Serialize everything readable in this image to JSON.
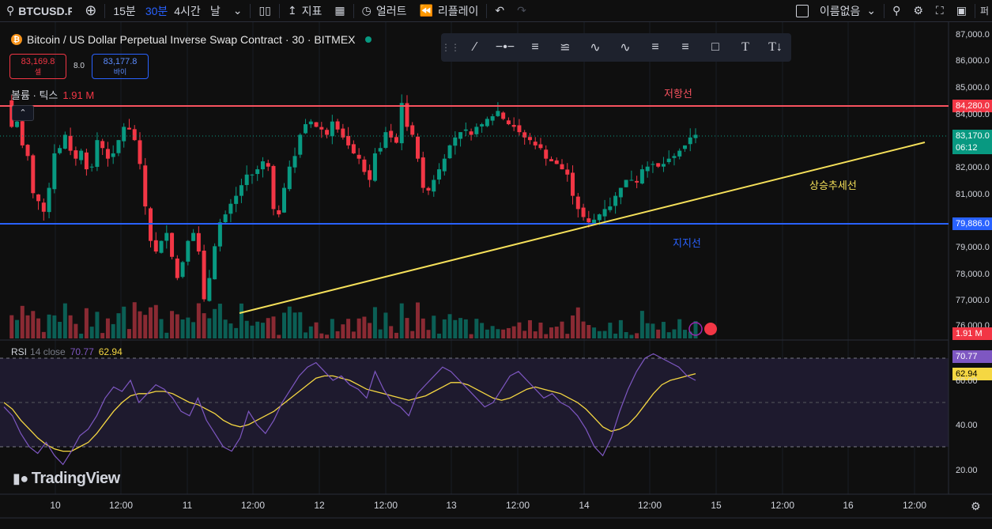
{
  "topbar": {
    "symbol": "BTCUSD.P",
    "intervals": [
      "15분",
      "30분",
      "4시간",
      "날"
    ],
    "active_interval": "30분",
    "indicators_label": "지표",
    "alert_label": "얼러트",
    "replay_label": "리플레이",
    "layout_name": "이름없음",
    "trailing": "퍼"
  },
  "legend": {
    "title": "Bitcoin / US Dollar Perpetual Inverse Swap Contract · 30 · BITMEX",
    "sell_price": "83,169.8",
    "sell_label": "셀",
    "spread": "8.0",
    "buy_price": "83,177.8",
    "buy_label": "바이",
    "volume_label": "볼륨 · 틱스",
    "volume_value": "1.91 M"
  },
  "annotations": {
    "resistance": "저항선",
    "support": "지지선",
    "uptrend": "상승추세선"
  },
  "price_axis": {
    "ticks": [
      "87,000.0",
      "86,000.0",
      "85,000.0",
      "84,000.0",
      "82,000.0",
      "81,000.0",
      "79,000.0",
      "78,000.0",
      "77,000.0",
      "76,000.0"
    ],
    "resistance_tag": "84,280.0",
    "last_price_tag": "83,170.0",
    "countdown": "06:12",
    "support_tag": "79,886.0",
    "volume_tag": "1.91 M"
  },
  "rsi": {
    "label": "RSI",
    "params": "14 close",
    "rsi_value": "70.77",
    "ma_value": "62.94",
    "axis_ticks": [
      "60.00",
      "40.00",
      "20.00"
    ]
  },
  "time_axis": {
    "labels": [
      "10",
      "12:00",
      "11",
      "12:00",
      "12",
      "12:00",
      "13",
      "12:00",
      "14",
      "12:00",
      "15",
      "12:00",
      "16",
      "12:00"
    ]
  },
  "branding": {
    "logo_text": "TradingView"
  },
  "colors": {
    "up": "#089981",
    "down": "#f23645",
    "resistance": "#f7525f",
    "support": "#2962ff",
    "trendline": "#f5e05a",
    "rsi_line": "#7e57c2",
    "rsi_ma": "#f5d742",
    "last_price": "#089981"
  },
  "chart_data": {
    "type": "candlestick",
    "symbol": "BTCUSD.P",
    "interval": "30",
    "x_labels": [
      "10",
      "12:00",
      "11",
      "12:00",
      "12",
      "12:00",
      "13",
      "12:00",
      "14",
      "12:00",
      "15",
      "12:00",
      "16",
      "12:00"
    ],
    "y_range": [
      75800,
      87200
    ],
    "resistance_level": 84280,
    "support_level": 79886,
    "last_price": 83170,
    "trendline": {
      "from_price": 76600,
      "to_price": 82900
    },
    "close_path": [
      84500,
      83500,
      83700,
      82800,
      82400,
      81000,
      80700,
      80300,
      81200,
      82500,
      82700,
      83200,
      82600,
      82300,
      82600,
      81900,
      82000,
      83000,
      82700,
      82300,
      82500,
      83000,
      83500,
      83400,
      83000,
      82100,
      80500,
      79200,
      78800,
      79200,
      79500,
      78600,
      77800,
      78400,
      79200,
      79500,
      78800,
      77000,
      77800,
      79000,
      79900,
      80200,
      80600,
      80900,
      81300,
      81700,
      81700,
      81900,
      82200,
      82000,
      80400,
      80200,
      81200,
      82000,
      82400,
      83200,
      83600,
      83700,
      83500,
      83400,
      83200,
      83700,
      83400,
      83100,
      82800,
      82500,
      82300,
      81800,
      81500,
      82500,
      82700,
      83300,
      83100,
      82900,
      84400,
      83500,
      83200,
      82300,
      81200,
      81100,
      81500,
      81900,
      82300,
      82800,
      83100,
      83300,
      83400,
      83200,
      83500,
      83600,
      83800,
      83900,
      84100,
      83800,
      83600,
      83500,
      83300,
      83100,
      83000,
      82800,
      82700,
      82300,
      82200,
      82100,
      81900,
      81700,
      80900,
      80400,
      80100,
      79900,
      80000,
      80200,
      80400,
      80500,
      80900,
      81200,
      81500,
      81500,
      81400,
      81900,
      82000,
      82100,
      82000,
      82100,
      82300,
      82400,
      82600,
      82800,
      83100,
      83200
    ],
    "rsi_path": [
      48,
      44,
      36,
      30,
      27,
      32,
      26,
      22,
      28,
      35,
      38,
      44,
      52,
      57,
      55,
      60,
      50,
      54,
      58,
      56,
      52,
      46,
      44,
      52,
      42,
      36,
      30,
      28,
      34,
      46,
      40,
      36,
      42,
      50,
      56,
      62,
      66,
      68,
      64,
      60,
      62,
      58,
      56,
      52,
      64,
      56,
      50,
      48,
      44,
      54,
      58,
      62,
      66,
      64,
      60,
      56,
      52,
      48,
      50,
      56,
      62,
      64,
      60,
      56,
      52,
      54,
      50,
      48,
      44,
      38,
      30,
      26,
      34,
      46,
      56,
      64,
      70,
      72,
      70,
      68,
      66,
      62,
      60
    ],
    "rsi_ma_path": [
      50,
      47,
      42,
      38,
      34,
      31,
      29,
      28,
      28,
      30,
      32,
      36,
      41,
      46,
      50,
      53,
      54,
      54,
      55,
      55,
      54,
      52,
      50,
      49,
      47,
      45,
      42,
      40,
      39,
      40,
      42,
      44,
      46,
      49,
      52,
      55,
      58,
      61,
      62,
      62,
      61,
      60,
      58,
      56,
      55,
      54,
      53,
      52,
      51,
      52,
      53,
      55,
      57,
      59,
      59,
      58,
      56,
      54,
      52,
      51,
      52,
      54,
      56,
      57,
      56,
      55,
      54,
      52,
      50,
      47,
      43,
      39,
      37,
      38,
      40,
      44,
      49,
      54,
      58,
      60,
      61,
      62,
      63
    ]
  }
}
